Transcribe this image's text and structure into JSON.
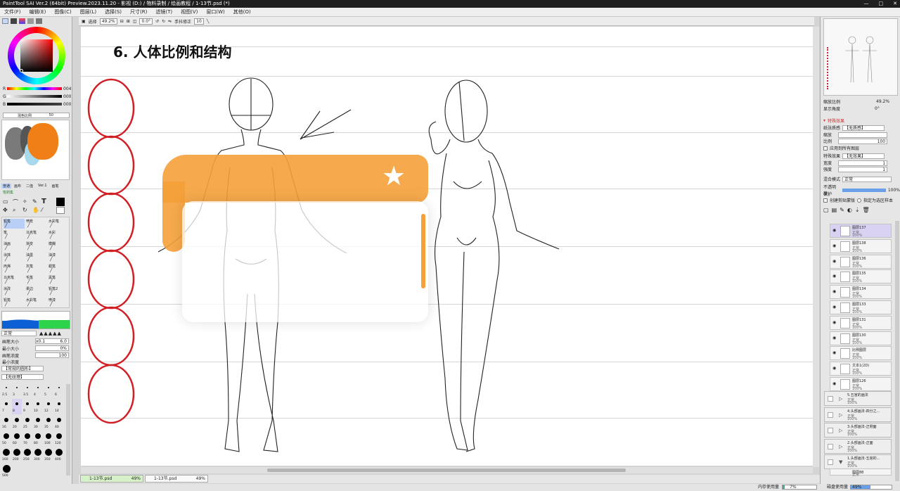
{
  "window": {
    "title": "PaintTool SAI Ver.2 (64bit) Preview.2023.11.20 - 影视 (D:) / 物料录制 / 绘画教程 / 1-13节.psd (*)",
    "controls": [
      "—",
      "□",
      "✕"
    ]
  },
  "menu": [
    "文件(F)",
    "编辑(E)",
    "图像(C)",
    "图层(L)",
    "选择(S)",
    "尺寸(R)",
    "滤镜(T)",
    "视图(V)",
    "窗口(W)",
    "其他(O)"
  ],
  "toolbar": {
    "select_label": "选择",
    "zoom": "49.2%",
    "angle": "0.0°",
    "stabilizer_label": "手抖修正",
    "stabilizer": "10"
  },
  "slides": {
    "heading": "6. 人体比例和结构"
  },
  "left": {
    "rgb": {
      "r_label": "R",
      "g_label": "G",
      "b_label": "B",
      "r_val": "004",
      "g_val": "000",
      "b_val": "000"
    },
    "mix": {
      "label": "混色比例",
      "value": "50"
    },
    "tool_tabs": [
      "普通",
      "画布",
      "二值",
      "Ver.1",
      "画笔"
    ],
    "set_label": "笔刷集",
    "tools": [
      [
        "铅笔",
        "喷枪",
        "水彩笔"
      ],
      [
        "笔",
        "马克笔",
        "水彩"
      ],
      [
        "油画",
        "渐变",
        "模糊"
      ],
      [
        "涂抹",
        "油墨",
        "油漆"
      ],
      [
        "丙烯",
        "灰笔",
        "蜡笔"
      ],
      [
        "马克笔",
        "毛笔",
        "黑笔"
      ],
      [
        "涂改",
        "柔边",
        "铅笔2"
      ],
      [
        "铅笔",
        "水彩笔",
        "喷漆"
      ]
    ],
    "blend_mode": "正常",
    "brush_size": {
      "label": "画笔大小",
      "mult": "x0.1",
      "value": "6.0"
    },
    "min_size": {
      "label": "最小大小",
      "value": "0%"
    },
    "density": {
      "label": "画笔浓度",
      "value": "100"
    },
    "min_density": {
      "label": "最小浓度"
    },
    "shape": "【常规的圆形】",
    "texture": "【无纹理】",
    "sizes": [
      "2.5",
      "3",
      "3.5",
      "4",
      "5",
      "6",
      "7",
      "8",
      "9",
      "10",
      "12",
      "14",
      "16",
      "20",
      "25",
      "30",
      "35",
      "40",
      "50",
      "60",
      "70",
      "80",
      "100",
      "120",
      "160",
      "200",
      "250",
      "300",
      "350",
      "400",
      "500"
    ]
  },
  "right": {
    "nav_zoom": {
      "label": "缩放比例",
      "value": "49.2%"
    },
    "nav_angle": {
      "label": "显示角度",
      "value": "0°"
    },
    "effect": {
      "title": "特殊效果",
      "paper_label": "纸张质感",
      "paper": "【无质感】",
      "scale_label": "缩放",
      "ratio_label": "比例",
      "ratio": "100",
      "apply_label": "应用到所有图层",
      "fx_label": "特殊效果",
      "fx": "【无效果】",
      "width_label": "宽度",
      "width": "1",
      "strength_label": "强度",
      "strength": "1"
    },
    "blend": {
      "label": "混合模式",
      "value": "正常"
    },
    "opacity": {
      "label": "不透明度",
      "value": "100%"
    },
    "protect_label": "保护",
    "clip_label": "创建剪贴蒙版",
    "ref_label": "指定为选区样本",
    "layers": [
      {
        "name": "图层137",
        "mode": "正常",
        "opacity": "100%",
        "selected": true
      },
      {
        "name": "图层138",
        "mode": "正常",
        "opacity": "100%"
      },
      {
        "name": "图层136",
        "mode": "正常",
        "opacity": "100%"
      },
      {
        "name": "图层135",
        "mode": "正常",
        "opacity": "100%"
      },
      {
        "name": "图层134",
        "mode": "正常",
        "opacity": "100%"
      },
      {
        "name": "图层133",
        "mode": "正常",
        "opacity": "100%"
      },
      {
        "name": "图层131",
        "mode": "正常",
        "opacity": "100%"
      },
      {
        "name": "图层130",
        "mode": "正常",
        "opacity": "100%"
      },
      {
        "name": "比例图层",
        "mode": "正常",
        "opacity": "100%"
      },
      {
        "name": "文本1(2D)",
        "mode": "正常",
        "opacity": "100%"
      },
      {
        "name": "图层126",
        "mode": "正常",
        "opacity": "100%"
      }
    ],
    "folders": [
      {
        "name": "5.五官的画法",
        "mode": "正常",
        "opacity": "100%"
      },
      {
        "name": "4.头部画法-四分之...",
        "mode": "正常",
        "opacity": "100%"
      },
      {
        "name": "3.头部画法-正侧面",
        "mode": "正常",
        "opacity": "100%"
      },
      {
        "name": "2.头部画法-正面",
        "mode": "正常",
        "opacity": "100%"
      },
      {
        "name": "1.头部画法-五官的...",
        "mode": "正常",
        "opacity": "100%"
      }
    ],
    "last_layer": {
      "name": "图层88",
      "mode": "正常"
    }
  },
  "tabs": [
    {
      "name": "1-13节.psd",
      "pct": "49%",
      "active": true
    },
    {
      "name": "1-13节.psd",
      "pct": "49%",
      "active": false
    }
  ],
  "status": {
    "mem_label": "内存使用量",
    "mem": "7%",
    "disk_label": "磁盘使用量",
    "disk": "49%"
  },
  "colors": {
    "accent_orange": "#f5a03a",
    "red_oval": "#d11f24",
    "ui_bg": "#e4e4e4"
  }
}
